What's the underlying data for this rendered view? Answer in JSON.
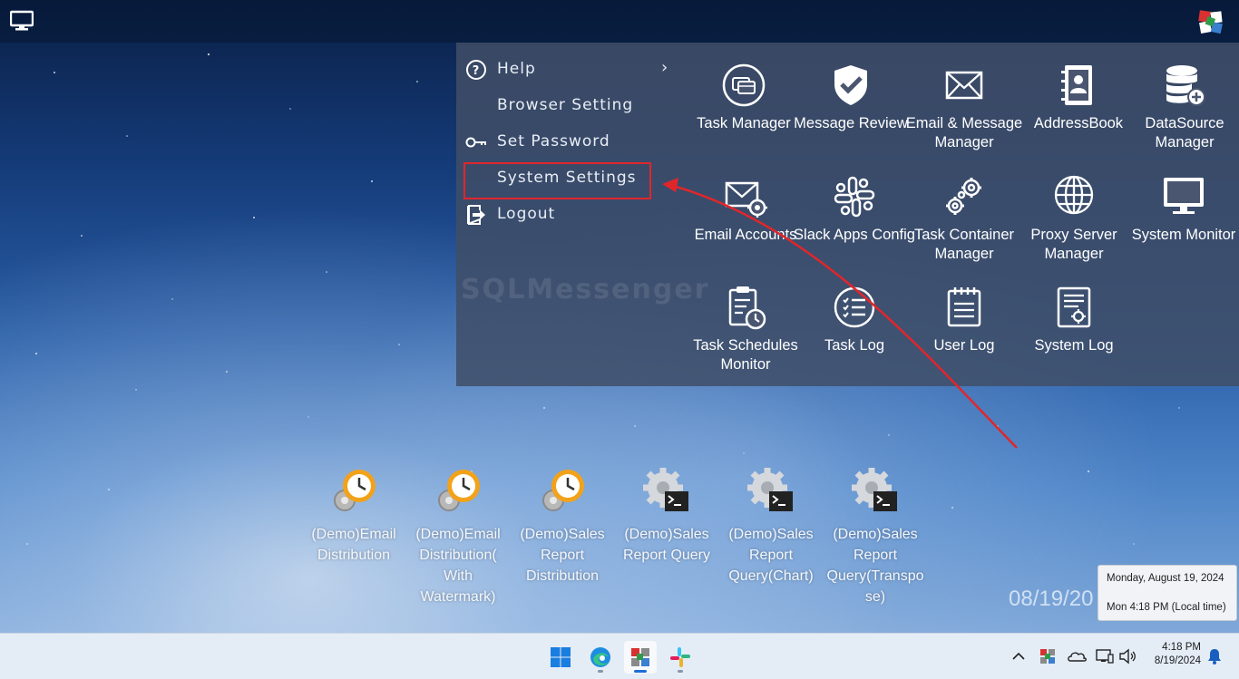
{
  "menu": {
    "items": [
      {
        "label": "Help",
        "icon": "help-circle-icon",
        "has_submenu": true
      },
      {
        "label": "Browser Setting",
        "icon": ""
      },
      {
        "label": "Set Password",
        "icon": "key-icon"
      },
      {
        "label": "System Settings",
        "icon": "",
        "highlighted": true
      },
      {
        "label": "Logout",
        "icon": "logout-icon"
      }
    ]
  },
  "watermark": "SQLMessenger",
  "tiles": [
    {
      "label": "Task Manager",
      "icon": "task-manager-icon"
    },
    {
      "label": "Message Review",
      "icon": "shield-check-icon"
    },
    {
      "label": "Email & Message Manager",
      "icon": "envelope-icon"
    },
    {
      "label": "AddressBook",
      "icon": "address-book-icon"
    },
    {
      "label": "DataSource Manager",
      "icon": "database-add-icon"
    },
    {
      "label": "Email Accounts",
      "icon": "email-settings-icon"
    },
    {
      "label": "Slack Apps Config",
      "icon": "slack-icon"
    },
    {
      "label": "Task Container Manager",
      "icon": "gears-icon"
    },
    {
      "label": "Proxy Server Manager",
      "icon": "globe-icon"
    },
    {
      "label": "System Monitor",
      "icon": "monitor-icon"
    },
    {
      "label": "Task Schedules Monitor",
      "icon": "clipboard-clock-icon"
    },
    {
      "label": "Task Log",
      "icon": "list-check-icon"
    },
    {
      "label": "User Log",
      "icon": "notepad-icon"
    },
    {
      "label": "System Log",
      "icon": "document-gear-icon"
    }
  ],
  "desktop": {
    "icons": [
      {
        "label": "(Demo)Email Distribution",
        "icon": "clock-gear-icon"
      },
      {
        "label": "(Demo)Email Distribution( With Watermark)",
        "icon": "clock-gear-icon"
      },
      {
        "label": "(Demo)Sales Report Distribution",
        "icon": "clock-gear-icon"
      },
      {
        "label": "(Demo)Sales Report Query",
        "icon": "gear-terminal-icon"
      },
      {
        "label": "(Demo)Sales Report Query(Chart)",
        "icon": "gear-terminal-icon"
      },
      {
        "label": "(Demo)Sales Report Query(Transpose)",
        "icon": "gear-terminal-icon"
      }
    ],
    "date_display": "08/19/20"
  },
  "tooltip": {
    "line1": "Monday, August 19, 2024",
    "line2": "Mon 4:18 PM (Local time)"
  },
  "taskbar": {
    "apps": [
      "windows-start-icon",
      "edge-icon",
      "sqlmessenger-icon",
      "slack-icon"
    ],
    "tray_icons": [
      "chevron-up-icon",
      "sqlmessenger-tray-icon",
      "onedrive-icon",
      "network-icon",
      "volume-icon"
    ],
    "time": "4:18 PM",
    "date": "8/19/2024"
  },
  "colors": {
    "highlight_border": "#e0262b",
    "panel_bg": "#404e68",
    "arrow": "#e0262b"
  }
}
